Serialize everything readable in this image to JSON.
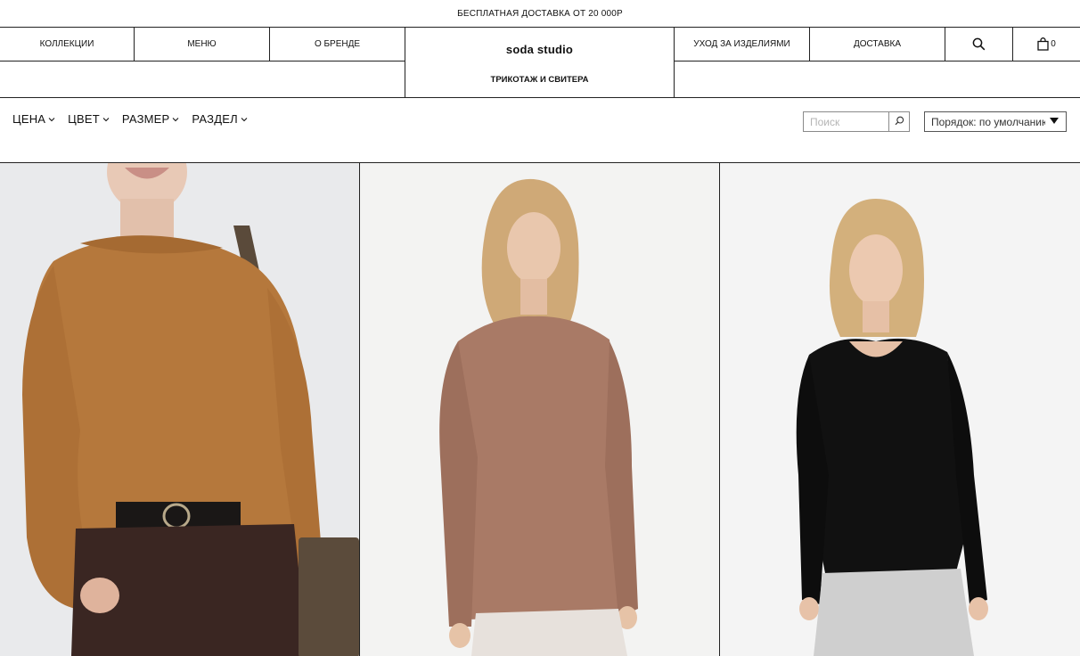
{
  "topbar": {
    "text": "БЕСПЛАТНАЯ ДОСТАВКА ОТ 20 000Р"
  },
  "nav": {
    "collections": "КОЛЛЕКЦИИ",
    "menu": "МЕНЮ",
    "about": "О БРЕНДЕ",
    "logo": "soda studio",
    "care": "УХОД ЗА ИЗДЕЛИЯМИ",
    "delivery": "ДОСТАВКА",
    "cart_count": "0",
    "category": "ТРИКОТАЖ И СВИТЕРА"
  },
  "filters": [
    {
      "label": "ЦЕНА"
    },
    {
      "label": "ЦВЕТ"
    },
    {
      "label": "РАЗМЕР"
    },
    {
      "label": "РАЗДЕЛ"
    }
  ],
  "search": {
    "placeholder": "Поиск"
  },
  "sort": {
    "value": "Порядок: по умолчанию"
  },
  "products": [
    {
      "image": "model-camel-knit-sweater",
      "color": "#b5783c"
    },
    {
      "image": "model-mocha-longsleeve",
      "color": "#a97a66"
    },
    {
      "image": "model-black-longsleeve",
      "color": "#111111"
    }
  ]
}
